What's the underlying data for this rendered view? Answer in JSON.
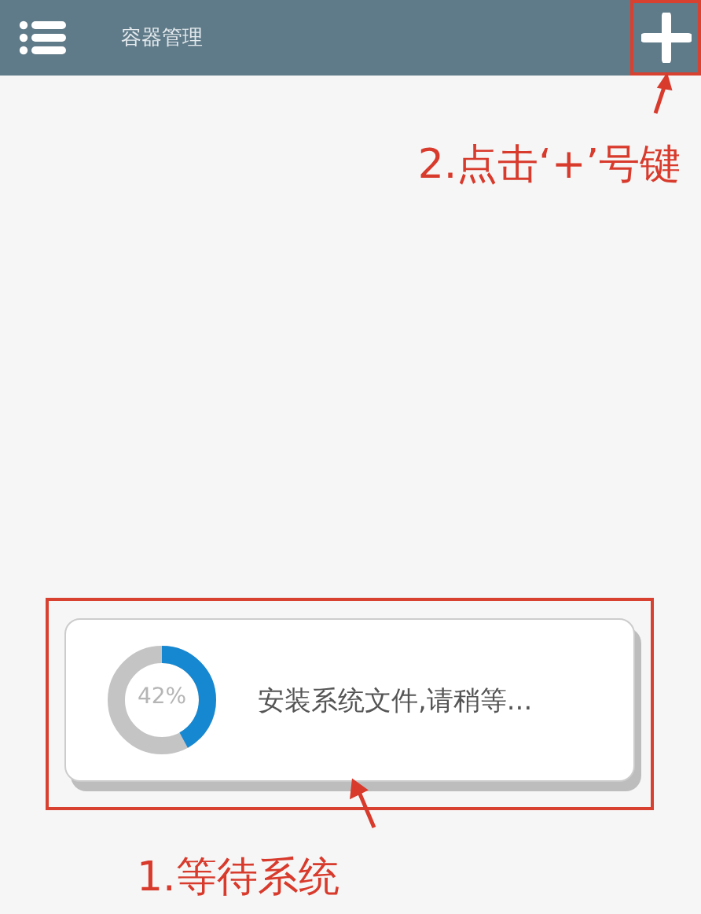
{
  "app_bar": {
    "title": "容器管理"
  },
  "annotations": [
    {
      "text": "2.点击‘+’号键"
    },
    {
      "text": "1.等待系统"
    }
  ],
  "progress_dialog": {
    "level": 0.42,
    "reading": "42%",
    "message": "安装系统文件,请稍等..."
  }
}
